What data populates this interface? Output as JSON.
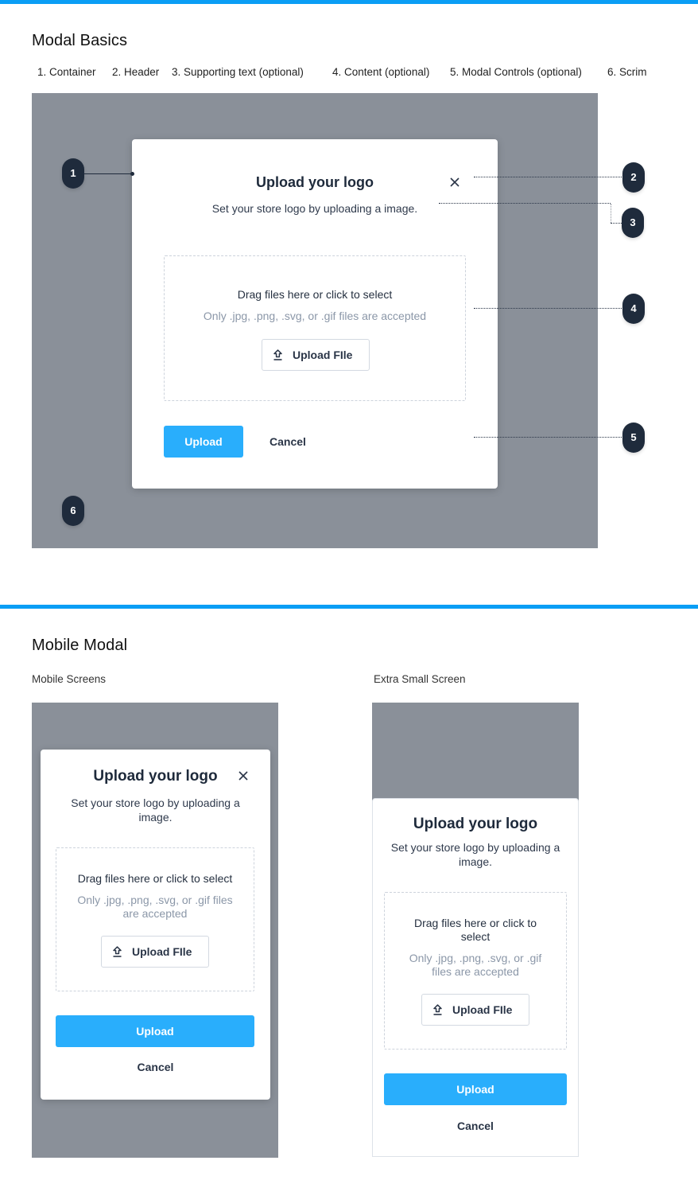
{
  "sections": {
    "basics": {
      "title": "Modal Basics",
      "legend": [
        "1. Container",
        "2. Header",
        "3. Supporting text (optional)",
        "4. Content (optional)",
        "5. Modal Controls (optional)",
        "6. Scrim"
      ],
      "badges": [
        "1",
        "2",
        "3",
        "4",
        "5",
        "6"
      ]
    },
    "mobile": {
      "title": "Mobile Modal",
      "mobile_label": "Mobile Screens",
      "xs_label": "Extra Small Screen"
    }
  },
  "modal": {
    "title": "Upload your logo",
    "subtitle": "Set your store logo by uploading a image.",
    "dropzone_main": "Drag files here or click to select",
    "dropzone_hint": "Only .jpg, .png, .svg, or .gif files are accepted",
    "upload_file_label": "Upload FIle",
    "upload_label": "Upload",
    "cancel_label": "Cancel",
    "close_icon": "close-icon",
    "upload_icon": "upload-arrow-icon"
  },
  "colors": {
    "accent_bar": "#0a9ef5",
    "primary_button": "#29aefc",
    "scrim": "#8a9099",
    "badge": "#1f2b3c"
  }
}
